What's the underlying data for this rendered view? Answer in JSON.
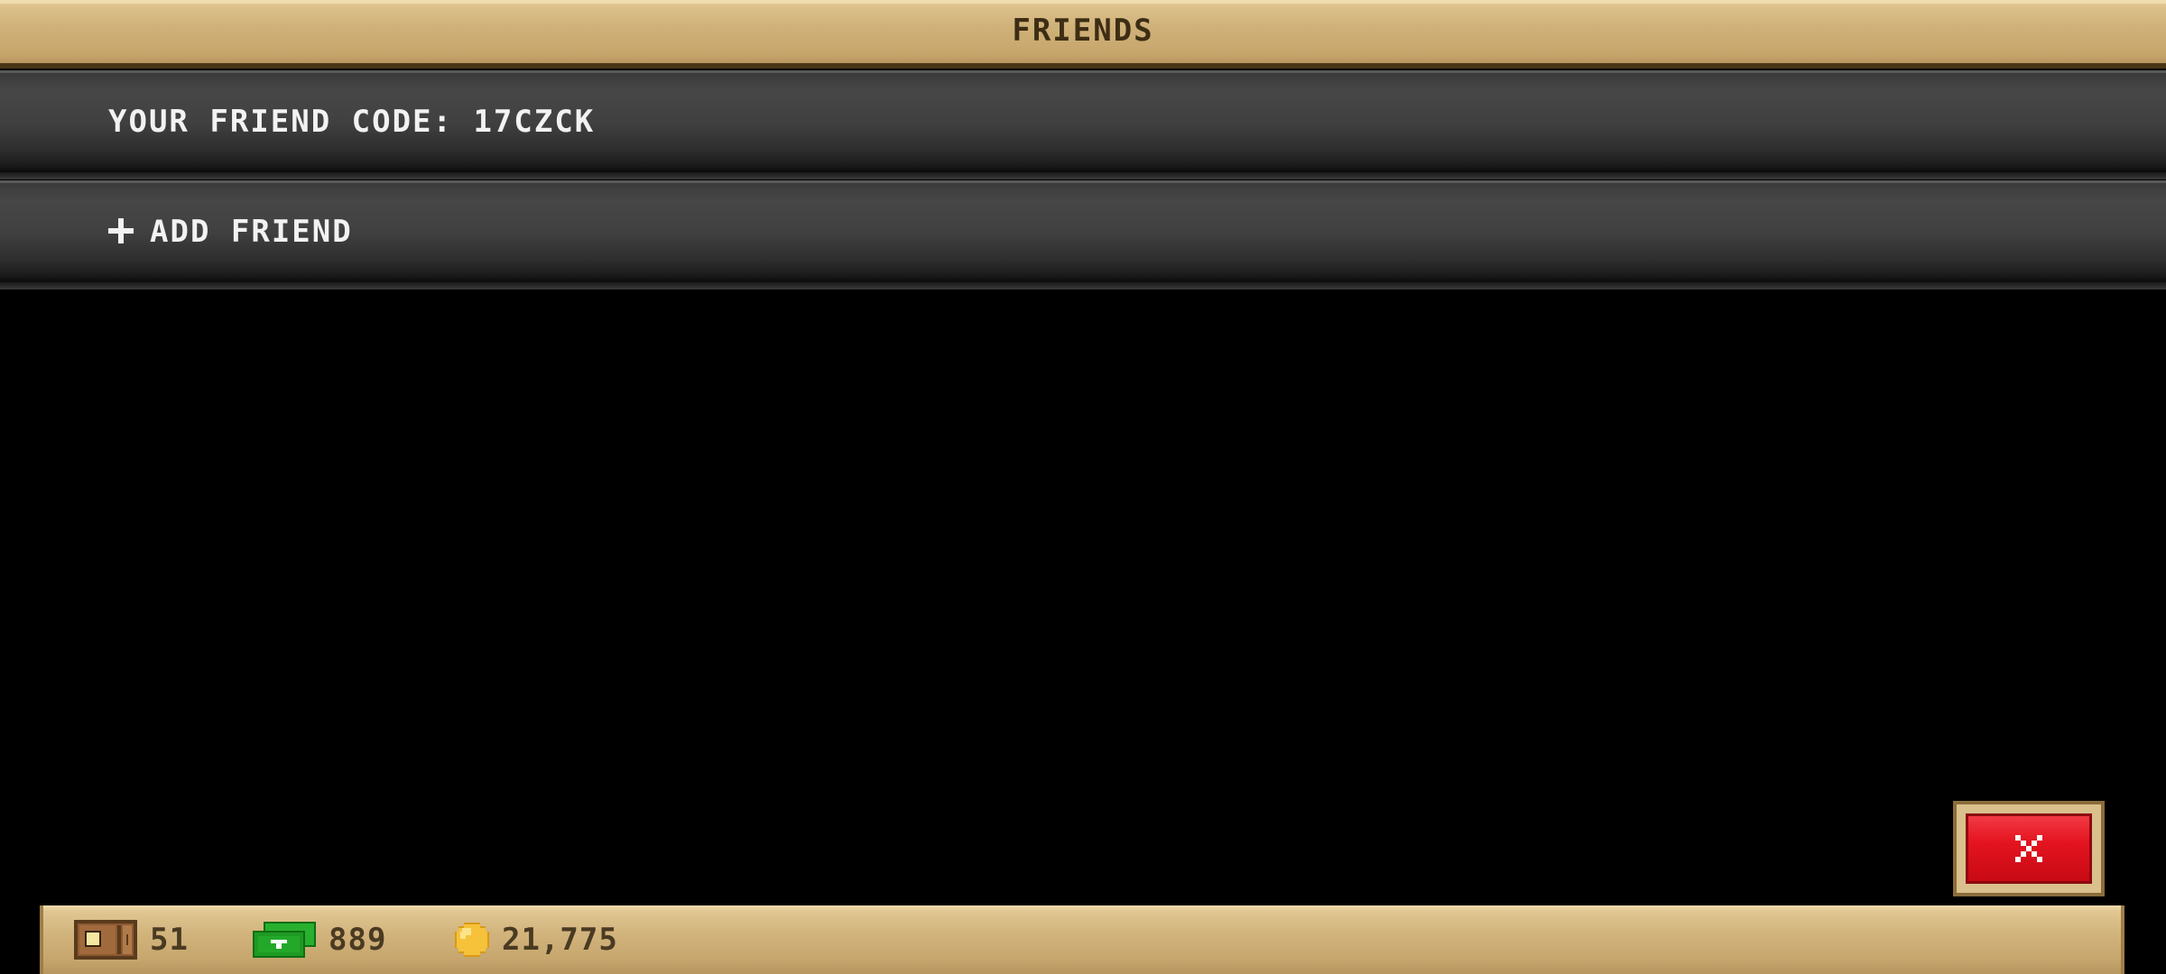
{
  "header": {
    "title": "FRIENDS"
  },
  "friend_code": {
    "text": "YOUR FRIEND CODE: 17CZCK"
  },
  "add_friend": {
    "label": "ADD FRIEND",
    "icon": "plus-icon"
  },
  "close_button": {
    "icon": "close-icon"
  },
  "currency": {
    "tickets": {
      "value": "51",
      "icon": "ticket-icon"
    },
    "cash": {
      "value": "889",
      "icon": "cash-icon"
    },
    "coins": {
      "value": "21,775",
      "icon": "coin-icon"
    }
  },
  "colors": {
    "gold_bar": "#c7a66c",
    "row_dark": "#404040",
    "close_red": "#e41420",
    "cash_green": "#1e9a22",
    "coin_gold": "#f5c23a"
  }
}
